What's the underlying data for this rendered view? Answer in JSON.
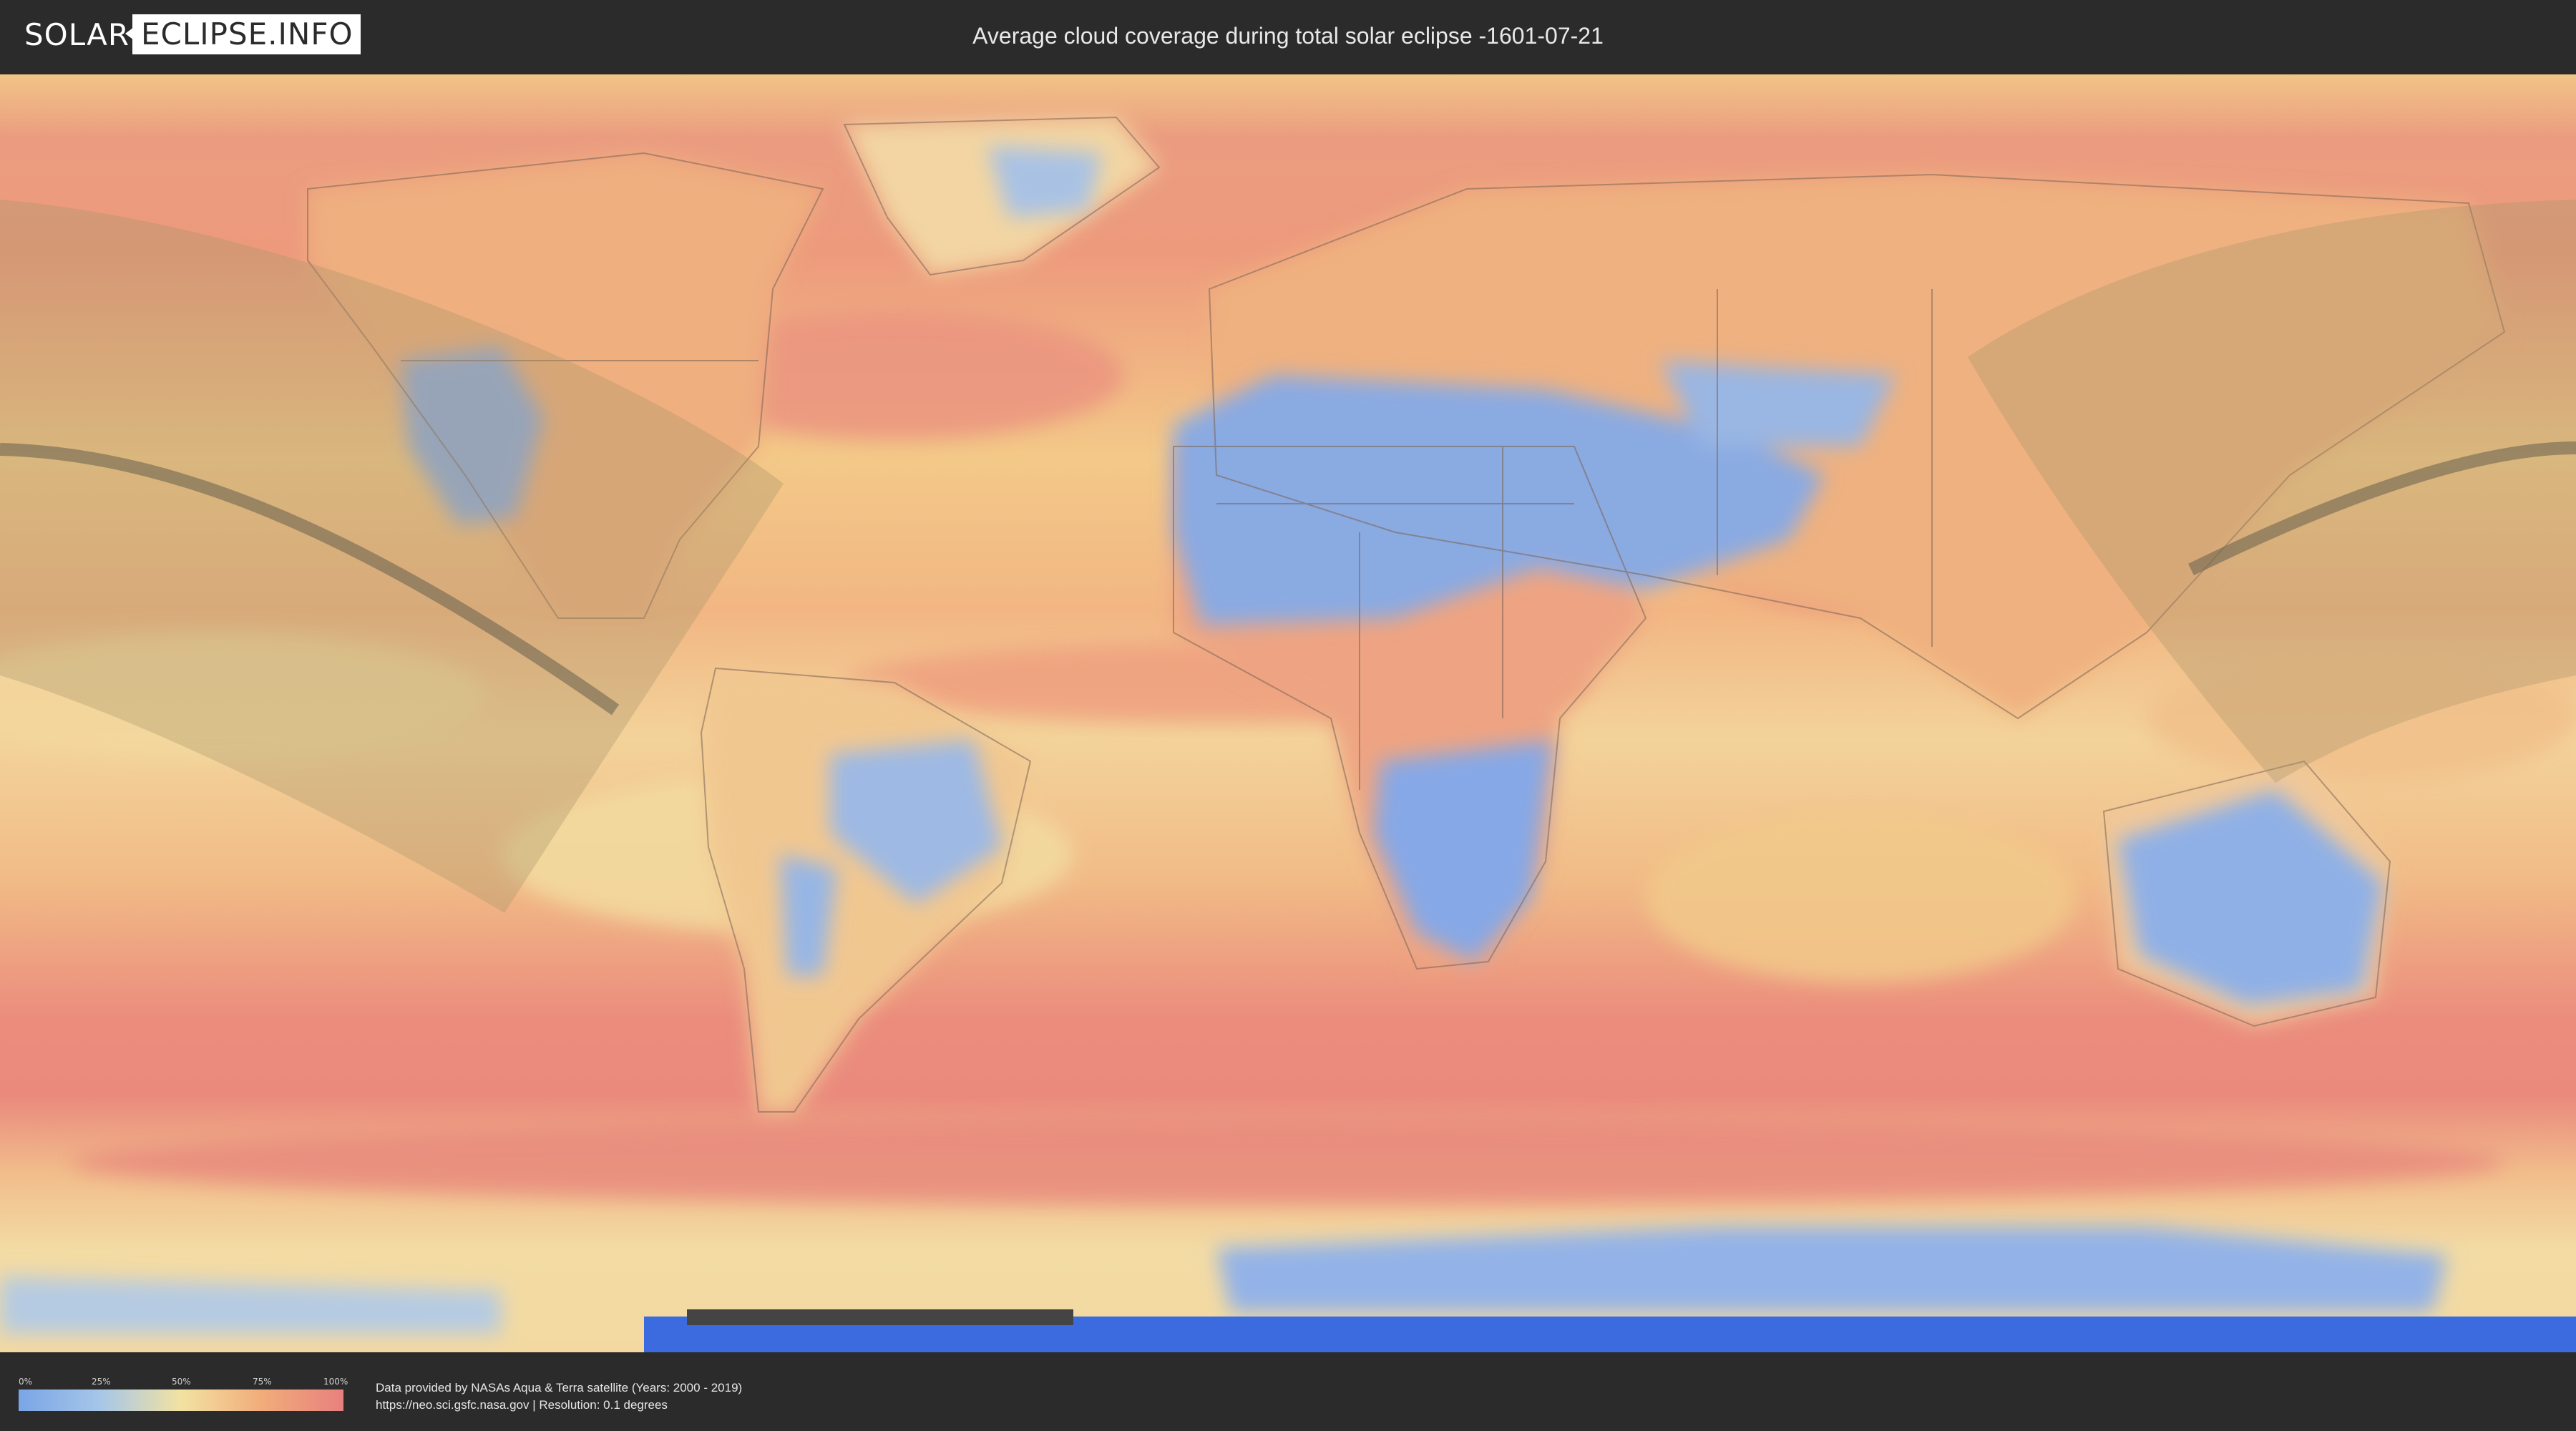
{
  "header": {
    "logo_left": "SOLAR",
    "logo_right": "ECLIPSE.INFO",
    "title": "Average cloud coverage during total solar eclipse -1601-07-21"
  },
  "legend": {
    "ticks": [
      "0%",
      "25%",
      "50%",
      "75%",
      "100%"
    ],
    "colors": [
      "#7aa5e6",
      "#a6c6e8",
      "#f2e2a2",
      "#f1ac7a",
      "#e8807e"
    ]
  },
  "footer": {
    "credit_line1": "Data provided by NASAs Aqua & Terra satellite (Years: 2000 - 2019)",
    "credit_line2": "https://neo.sci.gsfc.nasa.gov | Resolution: 0.1 degrees"
  },
  "map": {
    "projection": "equirectangular",
    "layers": [
      "cloud-coverage",
      "country-borders",
      "eclipse-visibility-zone",
      "totality-path"
    ],
    "colors": {
      "clear": "#7aa5e6",
      "mid": "#f2dd9b",
      "cloudy": "#e8847c",
      "zone_tint": "#a8946a",
      "path": "#6f6650"
    }
  }
}
